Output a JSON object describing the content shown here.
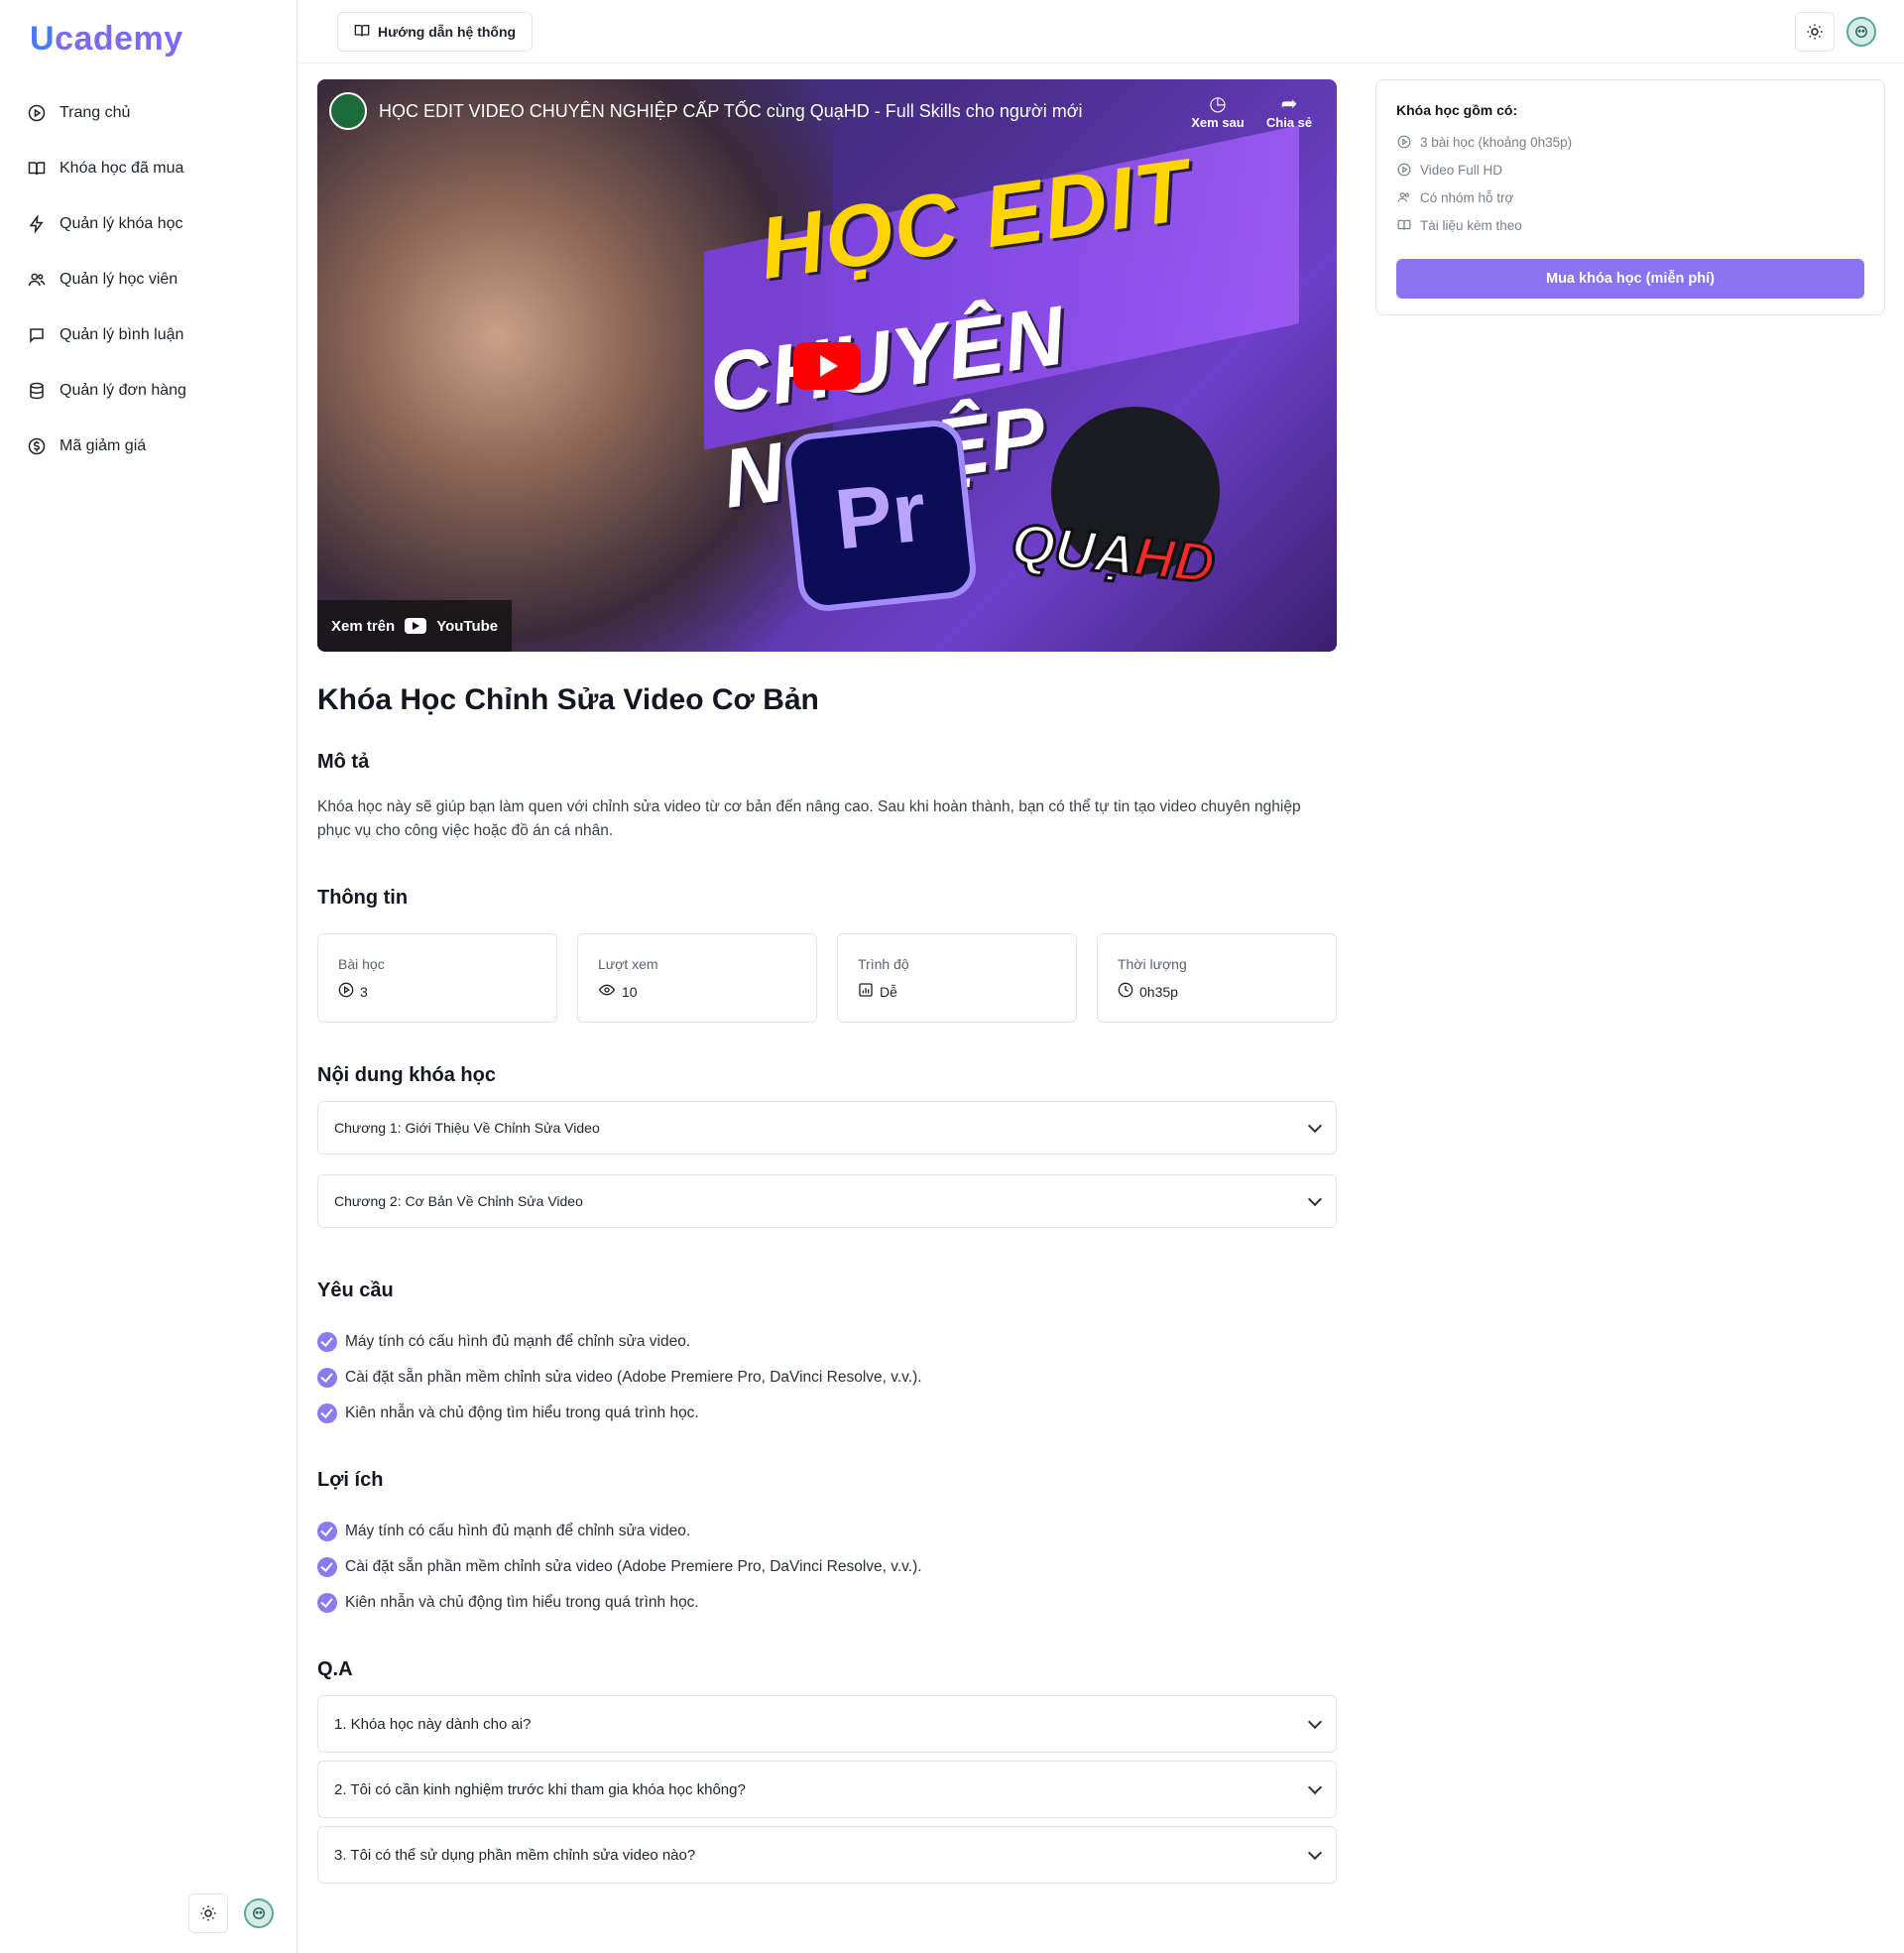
{
  "brand": {
    "logo_u": "U",
    "logo_rest": "cademy"
  },
  "sidebar": {
    "items": [
      {
        "label": "Trang chủ",
        "icon": "play-circle-icon"
      },
      {
        "label": "Khóa học đã mua",
        "icon": "book-open-icon"
      },
      {
        "label": "Quản lý khóa học",
        "icon": "lightning-icon"
      },
      {
        "label": "Quản lý học viên",
        "icon": "users-icon"
      },
      {
        "label": "Quản lý bình luận",
        "icon": "message-icon"
      },
      {
        "label": "Quản lý đơn hàng",
        "icon": "database-icon"
      },
      {
        "label": "Mã giảm giá",
        "icon": "dollar-circle-icon"
      }
    ]
  },
  "topbar": {
    "guide_label": "Hướng dẫn hệ thống"
  },
  "video": {
    "title": "HỌC EDIT VIDEO CHUYÊN NGHIỆP CẤP TỐC cùng QuạHD - Full Skills cho người mới",
    "watch_later": "Xem sau",
    "share": "Chia sẻ",
    "thumb_line1": "HỌC EDIT",
    "thumb_line2": "CHUYÊN NGHIỆP",
    "thumb_pr": "Pr",
    "thumb_brand_1": "QUẠ",
    "thumb_brand_2": "HD",
    "watch_on": "Xem trên",
    "youtube": "YouTube"
  },
  "course": {
    "title": "Khóa Học Chỉnh Sửa Video Cơ Bản",
    "description_heading": "Mô tả",
    "description": "Khóa học này sẽ giúp bạn làm quen với chỉnh sửa video từ cơ bản đến nâng cao. Sau khi hoàn thành, bạn có thể tự tin tạo video chuyên nghiệp phục vụ cho công việc hoặc đồ án cá nhân.",
    "info_heading": "Thông tin",
    "info": [
      {
        "label": "Bài học",
        "value": "3",
        "icon": "play-circle-icon"
      },
      {
        "label": "Lượt xem",
        "value": "10",
        "icon": "eye-icon"
      },
      {
        "label": "Trình độ",
        "value": "Dễ",
        "icon": "chart-icon"
      },
      {
        "label": "Thời lượng",
        "value": "0h35p",
        "icon": "clock-icon"
      }
    ],
    "content_heading": "Nội dung khóa học",
    "chapters": [
      "Chương 1: Giới Thiệu Về Chỉnh Sửa Video",
      "Chương 2: Cơ Bản Về Chỉnh Sửa Video"
    ],
    "requirements_heading": "Yêu cầu",
    "requirements": [
      "Máy tính có cấu hình đủ mạnh để chỉnh sửa video.",
      "Cài đặt sẵn phần mềm chỉnh sửa video (Adobe Premiere Pro, DaVinci Resolve, v.v.).",
      "Kiên nhẫn và chủ động tìm hiểu trong quá trình học."
    ],
    "benefits_heading": "Lợi ích",
    "benefits": [
      "Máy tính có cấu hình đủ mạnh để chỉnh sửa video.",
      "Cài đặt sẵn phần mềm chỉnh sửa video (Adobe Premiere Pro, DaVinci Resolve, v.v.).",
      "Kiên nhẫn và chủ động tìm hiểu trong quá trình học."
    ],
    "qa_heading": "Q.A",
    "qa": [
      "1. Khóa học này dành cho ai?",
      "2. Tôi có cần kinh nghiệm trước khi tham gia khóa học không?",
      "3. Tôi có thể sử dụng phần mềm chỉnh sửa video nào?"
    ]
  },
  "side_panel": {
    "title": "Khóa học gồm có:",
    "items": [
      {
        "label": "3 bài học (khoảng 0h35p)",
        "icon": "play-circle-icon"
      },
      {
        "label": "Video Full HD",
        "icon": "play-circle-icon"
      },
      {
        "label": "Có nhóm hỗ trợ",
        "icon": "users-icon"
      },
      {
        "label": "Tài liệu kèm theo",
        "icon": "book-open-icon"
      }
    ],
    "buy_label": "Mua khóa học (miễn phí)"
  },
  "colors": {
    "accent": "#8a74f2",
    "logo_blue": "#4a7bf2",
    "logo_purple": "#7d6af2"
  }
}
